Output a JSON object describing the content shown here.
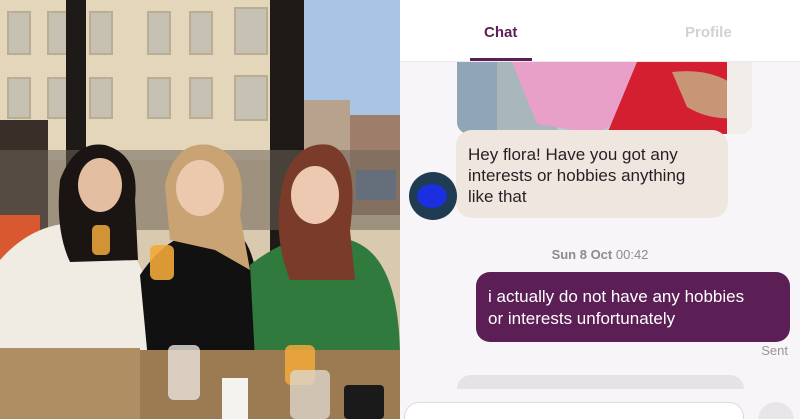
{
  "tabs": [
    {
      "label": "Chat",
      "active": true
    },
    {
      "label": "Profile",
      "active": false
    }
  ],
  "conversation": {
    "incoming": {
      "text_line1": "Hey flora! Have you got any",
      "text_line2": "interests or hobbies anything",
      "text_line3": "like that"
    },
    "timestamp": {
      "day": "Sun 8 Oct",
      "time": "00:42"
    },
    "outgoing": {
      "text_line1": "i actually do not have any hobbies",
      "text_line2": "or interests unfortunately",
      "status": "Sent"
    }
  },
  "composer": {
    "placeholder": ""
  },
  "colors": {
    "accent": "#5b1f55",
    "incoming_bubble": "#efe6e0",
    "background": "#f7f5f7"
  },
  "icons": [
    "avatar",
    "send-icon"
  ]
}
